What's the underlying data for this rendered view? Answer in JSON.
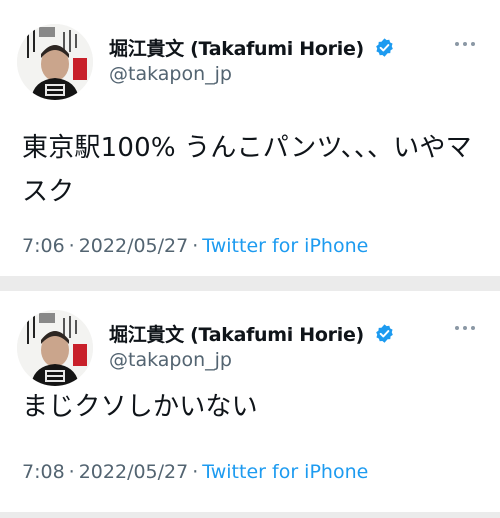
{
  "colors": {
    "background": "#ebebeb",
    "card": "#ffffff",
    "text": "#0f1419",
    "secondary_text": "#536471",
    "link": "#1d9bf0",
    "verified": "#1d9bf0"
  },
  "tweets": [
    {
      "author": {
        "display_name": "堀江貴文 (Takafumi Horie)",
        "handle": "@takapon_jp",
        "verified": true,
        "avatar_icon": "profile-photo",
        "verified_icon": "verified-badge-icon",
        "more_icon": "more-options-icon"
      },
      "text": "東京駅100% うんこパンツ、、、いやマスク",
      "time": "7:06",
      "date": "2022/05/27",
      "separator": "·",
      "source": "Twitter for iPhone"
    },
    {
      "author": {
        "display_name": "堀江貴文 (Takafumi Horie)",
        "handle": "@takapon_jp",
        "verified": true,
        "avatar_icon": "profile-photo",
        "verified_icon": "verified-badge-icon",
        "more_icon": "more-options-icon"
      },
      "text": "まじクソしかいない",
      "time": "7:08",
      "date": "2022/05/27",
      "separator": "·",
      "source": "Twitter for iPhone"
    }
  ]
}
